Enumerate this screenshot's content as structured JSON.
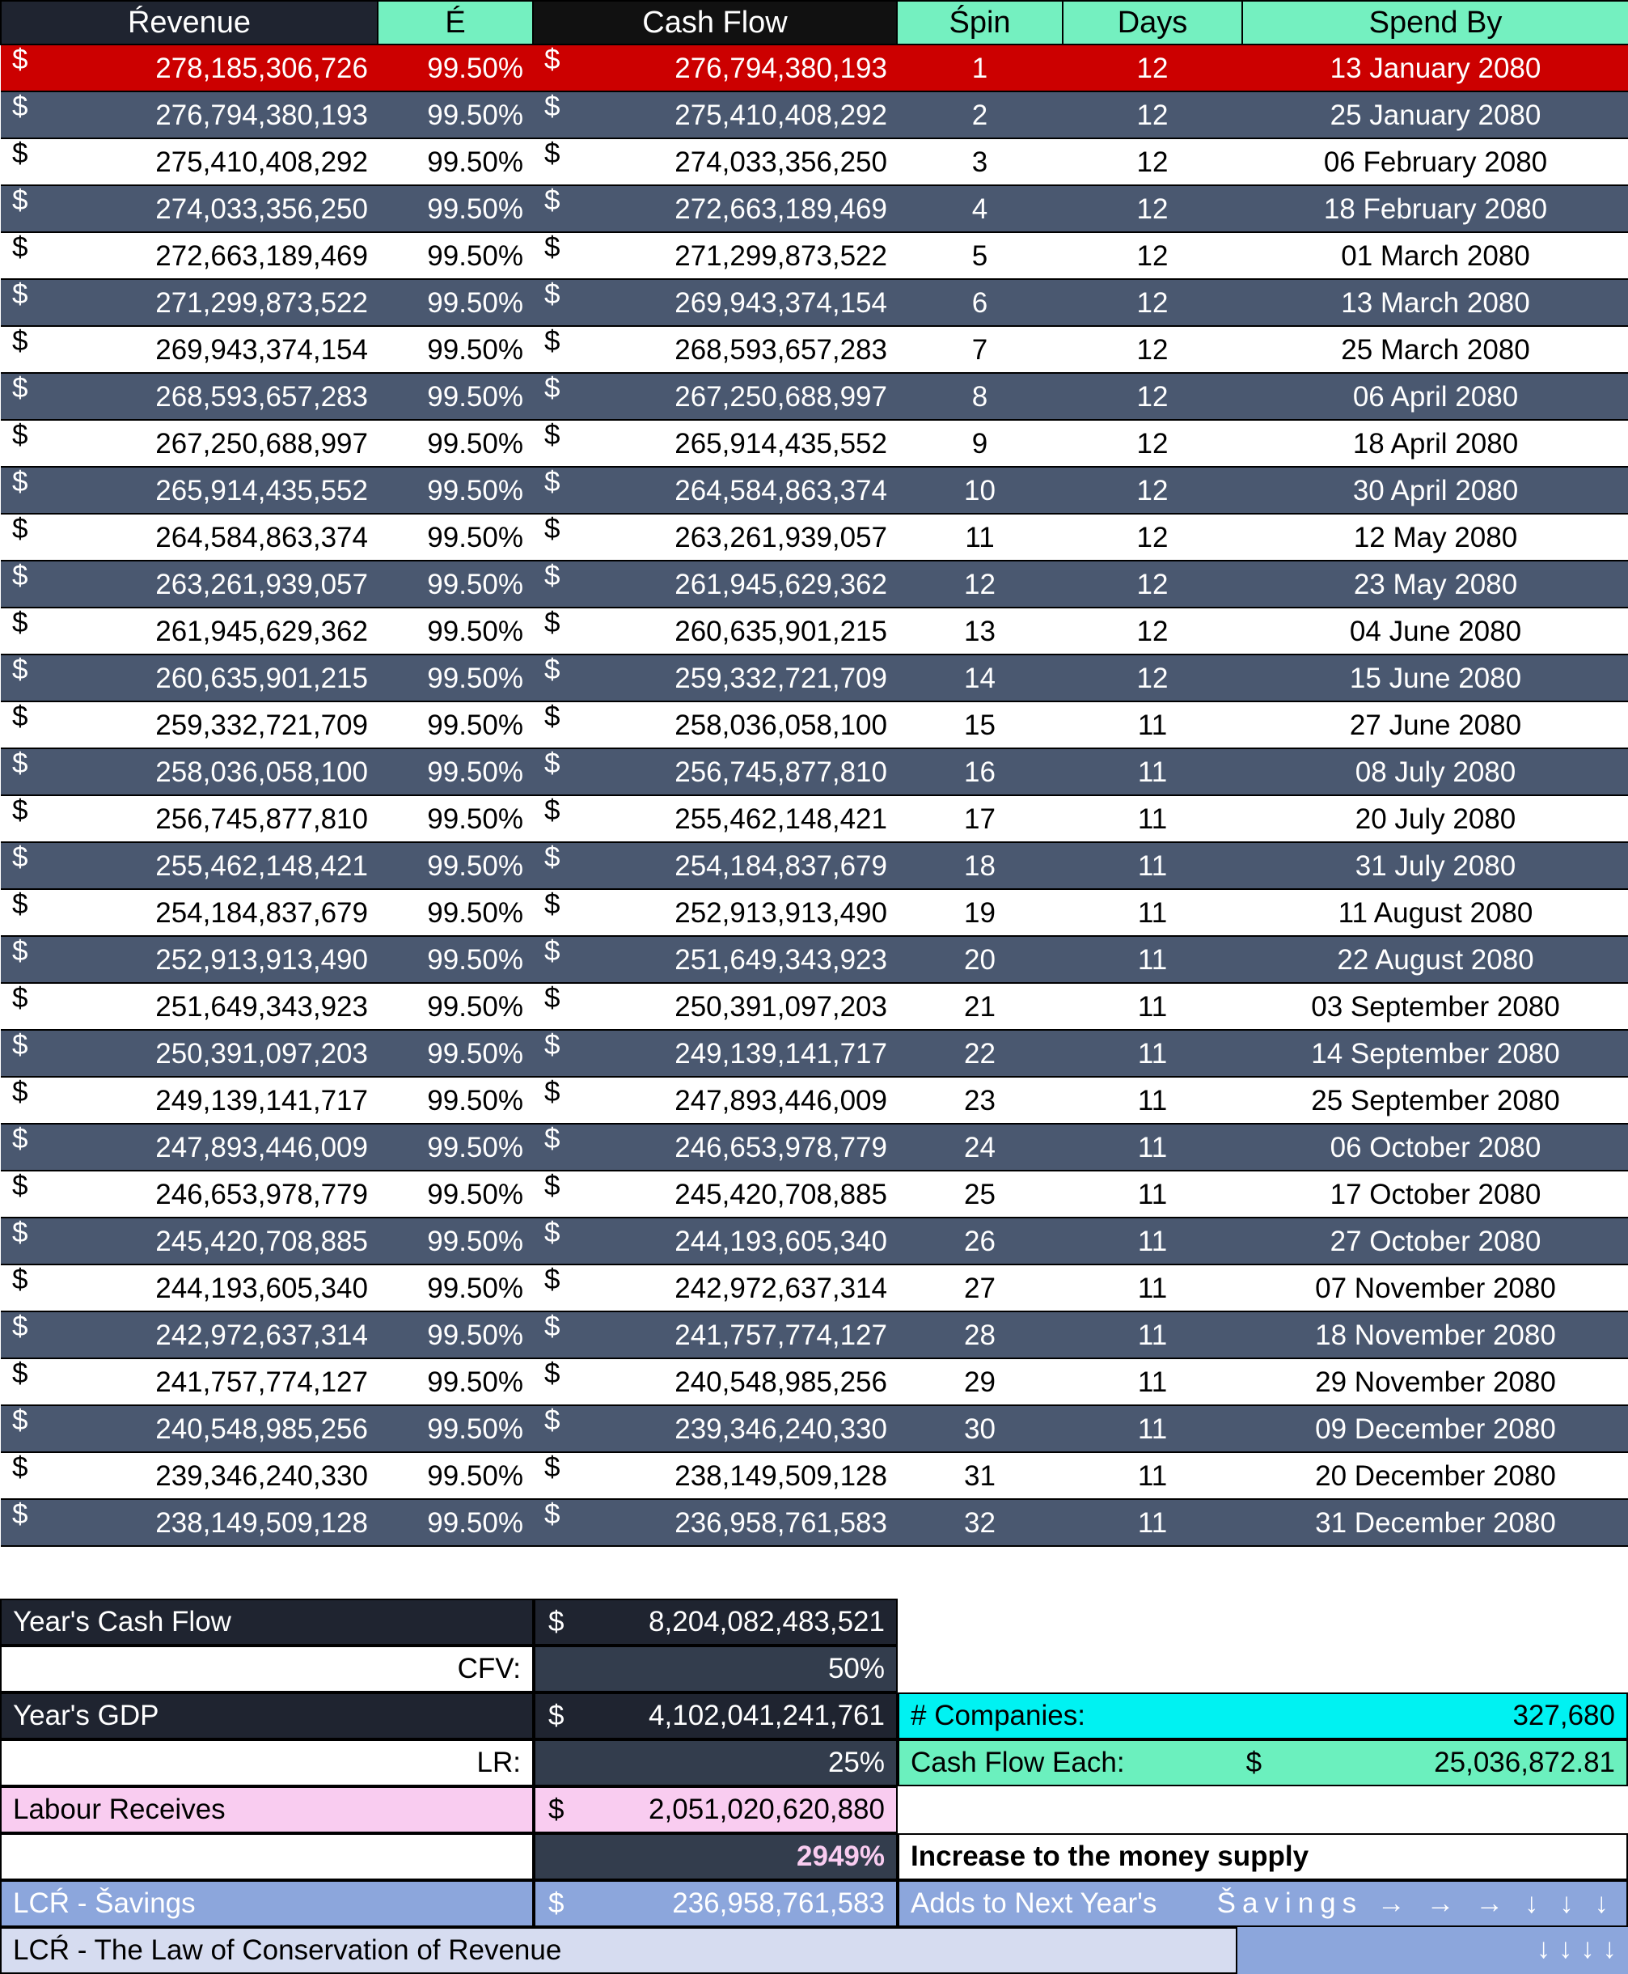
{
  "table": {
    "columns": [
      {
        "key": "revenue",
        "label": "Ŕevenue",
        "style": "dark"
      },
      {
        "key": "e",
        "label": "É",
        "style": "mint"
      },
      {
        "key": "cashflow",
        "label": "Cash Flow",
        "style": "black"
      },
      {
        "key": "spin",
        "label": "Śpin",
        "style": "mint"
      },
      {
        "key": "days",
        "label": "Days",
        "style": "mint"
      },
      {
        "key": "spendby",
        "label": "Spend By",
        "style": "mint"
      }
    ],
    "currency_symbol": "$",
    "rows": [
      {
        "revenue": "278,185,306,726",
        "e": "99.50%",
        "cashflow": "276,794,380,193",
        "spin": "1",
        "days": "12",
        "spendby": "13 January 2080",
        "style": "red"
      },
      {
        "revenue": "276,794,380,193",
        "e": "99.50%",
        "cashflow": "275,410,408,292",
        "spin": "2",
        "days": "12",
        "spendby": "25 January 2080",
        "style": "slate"
      },
      {
        "revenue": "275,410,408,292",
        "e": "99.50%",
        "cashflow": "274,033,356,250",
        "spin": "3",
        "days": "12",
        "spendby": "06 February 2080",
        "style": "white"
      },
      {
        "revenue": "274,033,356,250",
        "e": "99.50%",
        "cashflow": "272,663,189,469",
        "spin": "4",
        "days": "12",
        "spendby": "18 February 2080",
        "style": "slate"
      },
      {
        "revenue": "272,663,189,469",
        "e": "99.50%",
        "cashflow": "271,299,873,522",
        "spin": "5",
        "days": "12",
        "spendby": "01 March 2080",
        "style": "white"
      },
      {
        "revenue": "271,299,873,522",
        "e": "99.50%",
        "cashflow": "269,943,374,154",
        "spin": "6",
        "days": "12",
        "spendby": "13 March 2080",
        "style": "slate"
      },
      {
        "revenue": "269,943,374,154",
        "e": "99.50%",
        "cashflow": "268,593,657,283",
        "spin": "7",
        "days": "12",
        "spendby": "25 March 2080",
        "style": "white"
      },
      {
        "revenue": "268,593,657,283",
        "e": "99.50%",
        "cashflow": "267,250,688,997",
        "spin": "8",
        "days": "12",
        "spendby": "06 April 2080",
        "style": "slate"
      },
      {
        "revenue": "267,250,688,997",
        "e": "99.50%",
        "cashflow": "265,914,435,552",
        "spin": "9",
        "days": "12",
        "spendby": "18 April 2080",
        "style": "white"
      },
      {
        "revenue": "265,914,435,552",
        "e": "99.50%",
        "cashflow": "264,584,863,374",
        "spin": "10",
        "days": "12",
        "spendby": "30 April 2080",
        "style": "slate"
      },
      {
        "revenue": "264,584,863,374",
        "e": "99.50%",
        "cashflow": "263,261,939,057",
        "spin": "11",
        "days": "12",
        "spendby": "12 May 2080",
        "style": "white"
      },
      {
        "revenue": "263,261,939,057",
        "e": "99.50%",
        "cashflow": "261,945,629,362",
        "spin": "12",
        "days": "12",
        "spendby": "23 May 2080",
        "style": "slate"
      },
      {
        "revenue": "261,945,629,362",
        "e": "99.50%",
        "cashflow": "260,635,901,215",
        "spin": "13",
        "days": "12",
        "spendby": "04 June 2080",
        "style": "white"
      },
      {
        "revenue": "260,635,901,215",
        "e": "99.50%",
        "cashflow": "259,332,721,709",
        "spin": "14",
        "days": "12",
        "spendby": "15 June 2080",
        "style": "slate"
      },
      {
        "revenue": "259,332,721,709",
        "e": "99.50%",
        "cashflow": "258,036,058,100",
        "spin": "15",
        "days": "11",
        "spendby": "27 June 2080",
        "style": "white"
      },
      {
        "revenue": "258,036,058,100",
        "e": "99.50%",
        "cashflow": "256,745,877,810",
        "spin": "16",
        "days": "11",
        "spendby": "08 July 2080",
        "style": "slate"
      },
      {
        "revenue": "256,745,877,810",
        "e": "99.50%",
        "cashflow": "255,462,148,421",
        "spin": "17",
        "days": "11",
        "spendby": "20 July 2080",
        "style": "white"
      },
      {
        "revenue": "255,462,148,421",
        "e": "99.50%",
        "cashflow": "254,184,837,679",
        "spin": "18",
        "days": "11",
        "spendby": "31 July 2080",
        "style": "slate"
      },
      {
        "revenue": "254,184,837,679",
        "e": "99.50%",
        "cashflow": "252,913,913,490",
        "spin": "19",
        "days": "11",
        "spendby": "11 August 2080",
        "style": "white"
      },
      {
        "revenue": "252,913,913,490",
        "e": "99.50%",
        "cashflow": "251,649,343,923",
        "spin": "20",
        "days": "11",
        "spendby": "22 August 2080",
        "style": "slate"
      },
      {
        "revenue": "251,649,343,923",
        "e": "99.50%",
        "cashflow": "250,391,097,203",
        "spin": "21",
        "days": "11",
        "spendby": "03 September 2080",
        "style": "white"
      },
      {
        "revenue": "250,391,097,203",
        "e": "99.50%",
        "cashflow": "249,139,141,717",
        "spin": "22",
        "days": "11",
        "spendby": "14 September 2080",
        "style": "slate"
      },
      {
        "revenue": "249,139,141,717",
        "e": "99.50%",
        "cashflow": "247,893,446,009",
        "spin": "23",
        "days": "11",
        "spendby": "25 September 2080",
        "style": "white"
      },
      {
        "revenue": "247,893,446,009",
        "e": "99.50%",
        "cashflow": "246,653,978,779",
        "spin": "24",
        "days": "11",
        "spendby": "06 October 2080",
        "style": "slate"
      },
      {
        "revenue": "246,653,978,779",
        "e": "99.50%",
        "cashflow": "245,420,708,885",
        "spin": "25",
        "days": "11",
        "spendby": "17 October 2080",
        "style": "white"
      },
      {
        "revenue": "245,420,708,885",
        "e": "99.50%",
        "cashflow": "244,193,605,340",
        "spin": "26",
        "days": "11",
        "spendby": "27 October 2080",
        "style": "slate"
      },
      {
        "revenue": "244,193,605,340",
        "e": "99.50%",
        "cashflow": "242,972,637,314",
        "spin": "27",
        "days": "11",
        "spendby": "07 November 2080",
        "style": "white"
      },
      {
        "revenue": "242,972,637,314",
        "e": "99.50%",
        "cashflow": "241,757,774,127",
        "spin": "28",
        "days": "11",
        "spendby": "18 November 2080",
        "style": "slate"
      },
      {
        "revenue": "241,757,774,127",
        "e": "99.50%",
        "cashflow": "240,548,985,256",
        "spin": "29",
        "days": "11",
        "spendby": "29 November 2080",
        "style": "white"
      },
      {
        "revenue": "240,548,985,256",
        "e": "99.50%",
        "cashflow": "239,346,240,330",
        "spin": "30",
        "days": "11",
        "spendby": "09 December 2080",
        "style": "slate"
      },
      {
        "revenue": "239,346,240,330",
        "e": "99.50%",
        "cashflow": "238,149,509,128",
        "spin": "31",
        "days": "11",
        "spendby": "20 December 2080",
        "style": "white"
      },
      {
        "revenue": "238,149,509,128",
        "e": "99.50%",
        "cashflow": "236,958,761,583",
        "spin": "32",
        "days": "11",
        "spendby": "31 December 2080",
        "style": "slate"
      }
    ]
  },
  "summary": {
    "years_cash_flow_label": "Year's Cash Flow",
    "years_cash_flow_value": "8,204,082,483,521",
    "cfv_label": "CFV:",
    "cfv_value": "50%",
    "years_gdp_label": "Year's GDP",
    "years_gdp_value": "4,102,041,241,761",
    "lr_label": "LR:",
    "lr_value": "25%",
    "labour_receives_label": "Labour Receives",
    "labour_receives_value": "2,051,020,620,880",
    "money_supply_percent": "2949%",
    "money_supply_note": "Increase to the money supply",
    "companies_label": "# Companies:",
    "companies_value": "327,680",
    "cash_flow_each_label": "Cash Flow Each:",
    "cash_flow_each_value": "25,036,872.81",
    "currency_symbol": "$",
    "lcr_savings_label": "LCŔ  -  Šavings",
    "lcr_savings_value": "236,958,761,583",
    "lcr_savings_note": "Adds to Next Year's",
    "lcr_savings_arrows": "Šavings → → → ↓ ↓ ↓",
    "lcr_definition": "LCŔ  - The Law of Conservation of Revenue",
    "lcr_trailing_arrows": "↓  ↓  ↓  ↓"
  },
  "colors": {
    "header_dark": "#1F2430",
    "header_mint": "#74F0C0",
    "header_black": "#111111",
    "row_red": "#CC0000",
    "row_slate": "#4A5870",
    "summary_dark": "#1F2430",
    "summary_slate": "#333D4D",
    "pink": "#F9CCF0",
    "cyan": "#00F2F2",
    "mint": "#6BF0BE",
    "blue": "#8CA6DC",
    "lavender": "#D6DCF0"
  }
}
